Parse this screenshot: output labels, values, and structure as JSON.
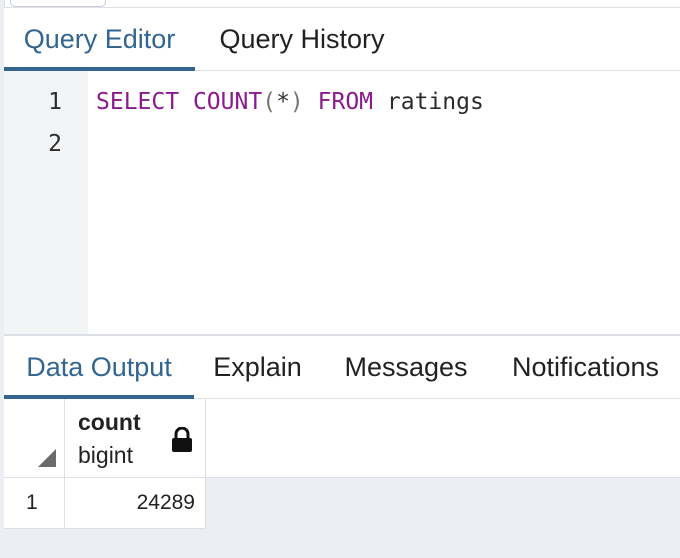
{
  "editor_tabs": [
    {
      "label": "Query Editor",
      "active": true
    },
    {
      "label": "Query History",
      "active": false
    }
  ],
  "editor": {
    "line_numbers": [
      "1",
      "2"
    ],
    "query_tokens": {
      "select": "SELECT",
      "count": "COUNT",
      "open_paren": "(",
      "star": "*",
      "close_paren": ")",
      "from": "FROM",
      "table": "ratings"
    }
  },
  "output_tabs": [
    {
      "label": "Data Output",
      "active": true
    },
    {
      "label": "Explain",
      "active": false
    },
    {
      "label": "Messages",
      "active": false
    },
    {
      "label": "Notifications",
      "active": false
    }
  ],
  "result_grid": {
    "columns": [
      {
        "name": "count",
        "type": "bigint",
        "icon": "lock-icon"
      }
    ],
    "rows": [
      {
        "row_number": "1",
        "values": [
          "24289"
        ]
      }
    ]
  },
  "colors": {
    "accent": "#326690",
    "keyword": "#8a1a8e",
    "panel_background": "#ebeef3",
    "gutter_background": "#f3f4f6"
  }
}
